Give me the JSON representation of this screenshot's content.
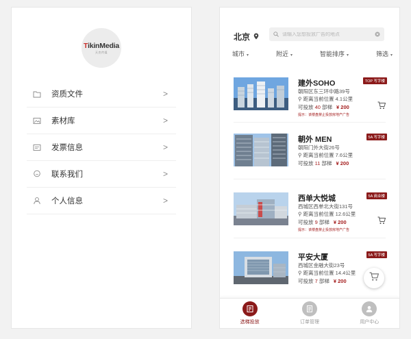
{
  "left": {
    "logo": {
      "prefix": "T",
      "name": "ikinMedia",
      "tagline": "天克传媒"
    },
    "menu": [
      {
        "label": "资质文件",
        "icon": "folder-icon"
      },
      {
        "label": "素材库",
        "icon": "image-library-icon"
      },
      {
        "label": "发票信息",
        "icon": "invoice-icon"
      },
      {
        "label": "联系我们",
        "icon": "chat-icon"
      },
      {
        "label": "个人信息",
        "icon": "user-icon"
      }
    ],
    "chevron": ">"
  },
  "right": {
    "city": "北京",
    "search_placeholder": "请输入您想投放广告的地点",
    "filters": [
      "城市",
      "附近",
      "智能排序",
      "筛选"
    ],
    "listings": [
      {
        "name": "建外SOHO",
        "badge": "TOP 写字楼",
        "address": "朝阳区东三环中路39号",
        "distance": "距离当前位置 4.1公里",
        "avail_prefix": "可投放 ",
        "avail_count": "40",
        "avail_suffix": " 部梯",
        "price": "¥ 200",
        "notice": "提示：该楼盘禁止投放房地产广告",
        "image": "skyline-towers"
      },
      {
        "name": "朝外 MEN",
        "badge": "5A 写字楼",
        "address": "朝阳门外大街26号",
        "distance": "距离当前位置 7.6公里",
        "avail_prefix": "可投放 ",
        "avail_count": "11",
        "avail_suffix": " 部梯",
        "price": "¥ 200",
        "notice": "",
        "image": "glass-tower"
      },
      {
        "name": "西单大悦城",
        "badge": "5A 商业楼",
        "address": "西城区西单北大街131号",
        "distance": "距离当前位置 12.6公里",
        "avail_prefix": "可投放 ",
        "avail_count": "9",
        "avail_suffix": " 部梯",
        "price": "¥ 200",
        "notice": "提示：该楼盘禁止投放房地产广告",
        "image": "mall-building"
      },
      {
        "name": "平安大厦",
        "badge": "5A 写字楼",
        "address": "西城区金融大街23号",
        "distance": "距离当前位置 14.4公里",
        "avail_prefix": "可投放 ",
        "avail_count": "7",
        "avail_suffix": " 部梯",
        "price": "¥ 200",
        "notice": "",
        "image": "office-block"
      }
    ],
    "tabs": [
      {
        "label": "选梯投放",
        "icon": "elevator-icon",
        "active": true
      },
      {
        "label": "订单管理",
        "icon": "order-icon",
        "active": false
      },
      {
        "label": "用户中心",
        "icon": "user-icon",
        "active": false
      }
    ]
  },
  "colors": {
    "accent": "#8b1a1a",
    "price": "#a41e1e",
    "background": "#f2f2f2"
  }
}
